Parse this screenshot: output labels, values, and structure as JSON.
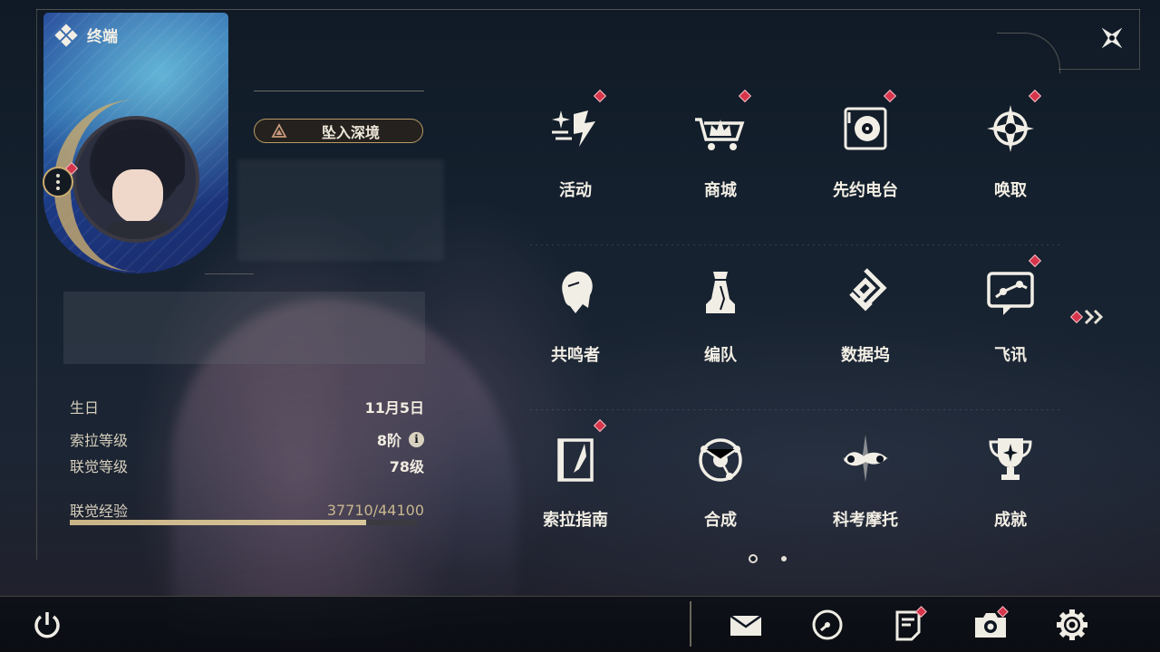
{
  "header": {
    "title": "终端",
    "icon": "diamond-cluster-icon"
  },
  "profile": {
    "status_label": "坠入深境",
    "rows": [
      {
        "label": "生日",
        "value": "11月5日"
      },
      {
        "label": "索拉等级",
        "value": "8阶"
      },
      {
        "label": "联觉等级",
        "value": "78级"
      }
    ],
    "exp": {
      "label": "联觉经验",
      "value": "37710/44100",
      "progress": 0.855
    }
  },
  "menu": [
    {
      "label": "活动",
      "icon": "event-sparkle-icon",
      "badge": true
    },
    {
      "label": "商城",
      "icon": "shop-cart-icon",
      "badge": true
    },
    {
      "label": "先约电台",
      "icon": "radio-vinyl-icon",
      "badge": true
    },
    {
      "label": "唤取",
      "icon": "compass-star-icon",
      "badge": true
    },
    {
      "label": "共鸣者",
      "icon": "resonator-head-icon",
      "badge": false
    },
    {
      "label": "编队",
      "icon": "chess-team-icon",
      "badge": false
    },
    {
      "label": "数据坞",
      "icon": "data-dock-icon",
      "badge": false
    },
    {
      "label": "飞讯",
      "icon": "chat-message-icon",
      "badge": true
    },
    {
      "label": "索拉指南",
      "icon": "guide-book-icon",
      "badge": true
    },
    {
      "label": "合成",
      "icon": "synthesis-orbit-icon",
      "badge": false
    },
    {
      "label": "科考摩托",
      "icon": "motorcycle-icon",
      "badge": false
    },
    {
      "label": "成就",
      "icon": "trophy-icon",
      "badge": false
    }
  ],
  "pager": {
    "current": 1,
    "total": 2
  },
  "bottom": [
    {
      "name": "mail",
      "icon": "mail-icon",
      "badge": false
    },
    {
      "name": "clock",
      "icon": "clock-icon",
      "badge": false
    },
    {
      "name": "notice",
      "icon": "notice-icon",
      "badge": true
    },
    {
      "name": "camera",
      "icon": "camera-icon",
      "badge": true
    },
    {
      "name": "settings",
      "icon": "gear-icon",
      "badge": false
    }
  ],
  "colors": {
    "accent": "#c9ab6e",
    "badge": "#d6354b",
    "text": "#f2eee4"
  }
}
